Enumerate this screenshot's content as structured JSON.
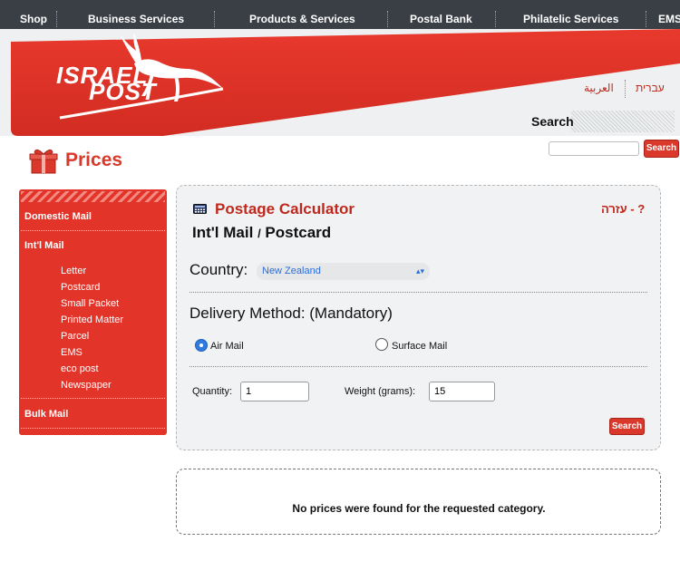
{
  "topnav": {
    "items": [
      "Shop",
      "Business Services",
      "Products & Services",
      "Postal Bank",
      "Philatelic Services",
      "EMS"
    ]
  },
  "header": {
    "logo_line1": "ISRAEL",
    "logo_line2": "POST",
    "lang_arabic": "العربية",
    "lang_hebrew": "עברית",
    "search_label": "Search",
    "search_value": "",
    "search_button": "Search"
  },
  "page": {
    "title": "Prices"
  },
  "sidebar": {
    "domestic": "Domestic Mail",
    "intl": "Int'l Mail",
    "sub_items": [
      "Letter",
      "Postcard",
      "Small Packet",
      "Printed Matter",
      "Parcel",
      "EMS",
      "eco post",
      "Newspaper"
    ],
    "bulk": "Bulk Mail"
  },
  "calculator": {
    "title": "Postage Calculator",
    "help": "עזרה - ?",
    "category_main": "Int'l Mail",
    "category_sep": "/",
    "category_sub": "Postcard",
    "country_label": "Country:",
    "country_value": "New Zealand",
    "delivery_label": "Delivery Method: (Mandatory)",
    "air_mail": "Air Mail",
    "surface_mail": "Surface Mail",
    "selected_method": "Air Mail",
    "quantity_label": "Quantity:",
    "quantity_value": "1",
    "weight_label": "Weight (grams):",
    "weight_value": "15",
    "search_button": "Search"
  },
  "result": {
    "message": "No prices were found for the requested category."
  },
  "colors": {
    "brand_red": "#d9382b",
    "nav_dark": "#3a3f45",
    "link_blue": "#2b6dd8"
  }
}
